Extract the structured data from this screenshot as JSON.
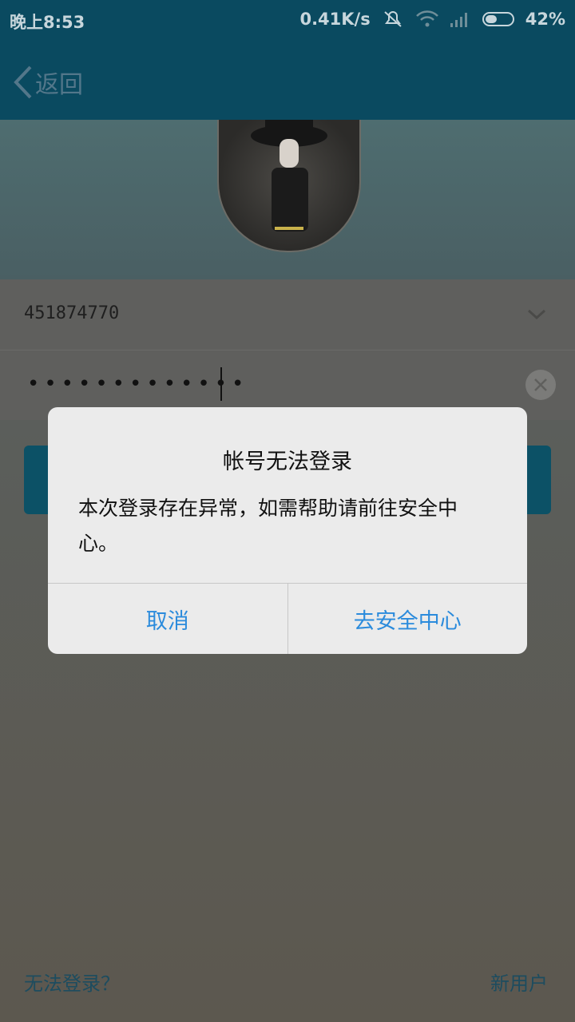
{
  "status_bar": {
    "time": "晚上8:53",
    "network_speed": "0.41K/s",
    "battery_percent": "42%",
    "icons": [
      "mute-icon",
      "wifi-icon",
      "signal-icon",
      "battery-icon"
    ]
  },
  "header": {
    "back_label": "返回"
  },
  "login": {
    "account": "451874770",
    "password_masked": "•••••••••••••"
  },
  "footer": {
    "cannot_login": "无法登录？",
    "new_user": "新用户"
  },
  "dialog": {
    "title": "帐号无法登录",
    "message": "本次登录存在异常，如需帮助请前往安全中心。",
    "cancel": "取消",
    "confirm": "去安全中心"
  },
  "colors": {
    "header": "#0a4a60",
    "dialog_button_text": "#2b8bdc",
    "footer_link": "#1d4c5f"
  }
}
